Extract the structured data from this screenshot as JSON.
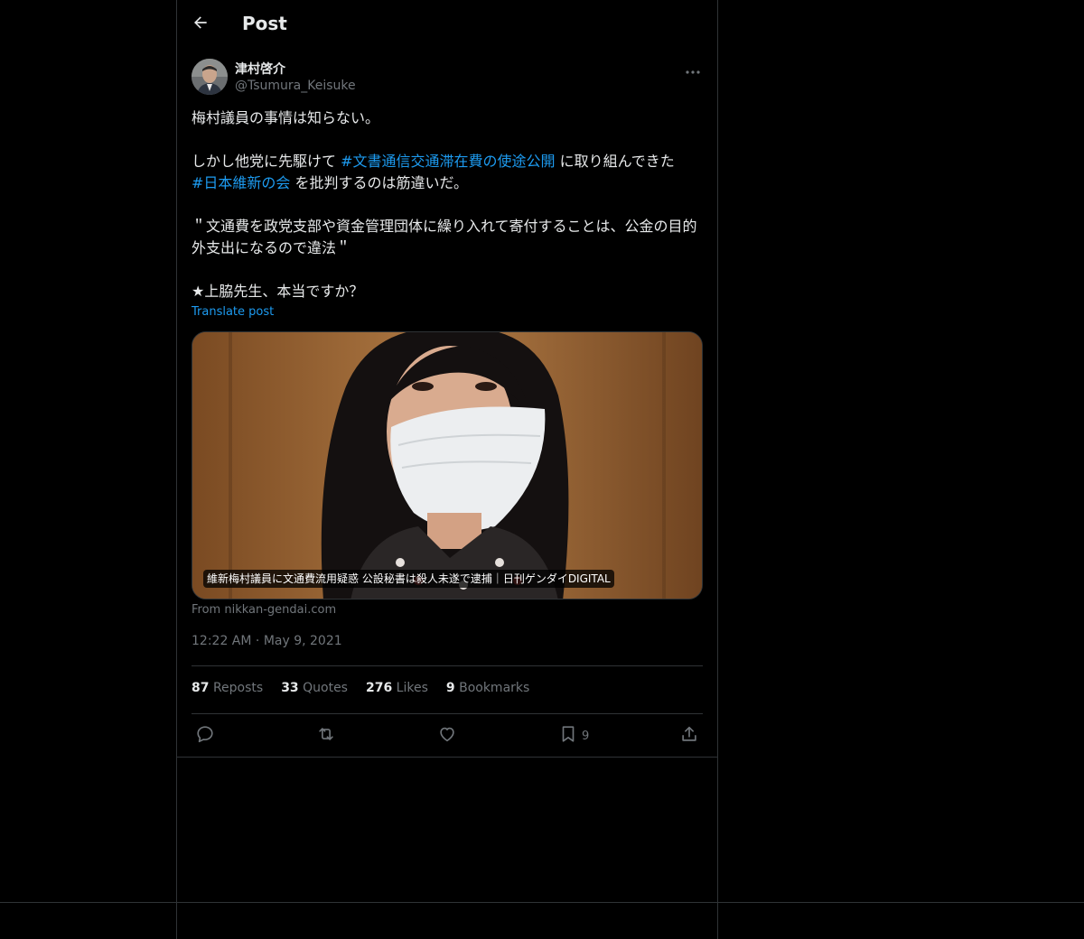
{
  "header": {
    "back_icon": "arrow-left-icon",
    "title": "Post"
  },
  "author": {
    "name": "津村啓介",
    "handle": "@Tsumura_Keisuke",
    "more_icon": "more-dots-icon"
  },
  "post": {
    "line1": "梅村議員の事情は知らない。",
    "line2_prefix": "しかし他党に先駆けて ",
    "hashtag1": "#文書通信交通滞在費の使途公開",
    "line2_suffix": " に取り組んできた",
    "hashtag2": "#日本維新の会",
    "line3_suffix": " を批判するのは筋違いだ。",
    "quote": "＂文通費を政党支部や資金管理団体に繰り入れて寄付することは、公金の目的外支出になるので違法＂",
    "closing": "★上脇先生、本当ですか？",
    "translate_label": "Translate post"
  },
  "card": {
    "caption": "維新梅村議員に文通費流用疑惑 公設秘書は殺人未遂で逮捕｜日刊ゲンダイDIGITAL",
    "source": "From nikkan-gendai.com"
  },
  "meta": {
    "time": "12:22 AM",
    "separator": "·",
    "date": "May 9, 2021"
  },
  "stats": {
    "reposts_count": "87",
    "reposts_label": "Reposts",
    "quotes_count": "33",
    "quotes_label": "Quotes",
    "likes_count": "276",
    "likes_label": "Likes",
    "bookmarks_count": "9",
    "bookmarks_label": "Bookmarks"
  },
  "actions": {
    "reply_icon": "reply-icon",
    "repost_icon": "repost-icon",
    "like_icon": "heart-icon",
    "bookmark_icon": "bookmark-icon",
    "bookmark_count": "9",
    "share_icon": "share-icon"
  },
  "colors": {
    "background": "#000000",
    "text": "#e7e9ea",
    "muted": "#71767b",
    "accent": "#1d9bf0",
    "border": "#2f3336"
  }
}
